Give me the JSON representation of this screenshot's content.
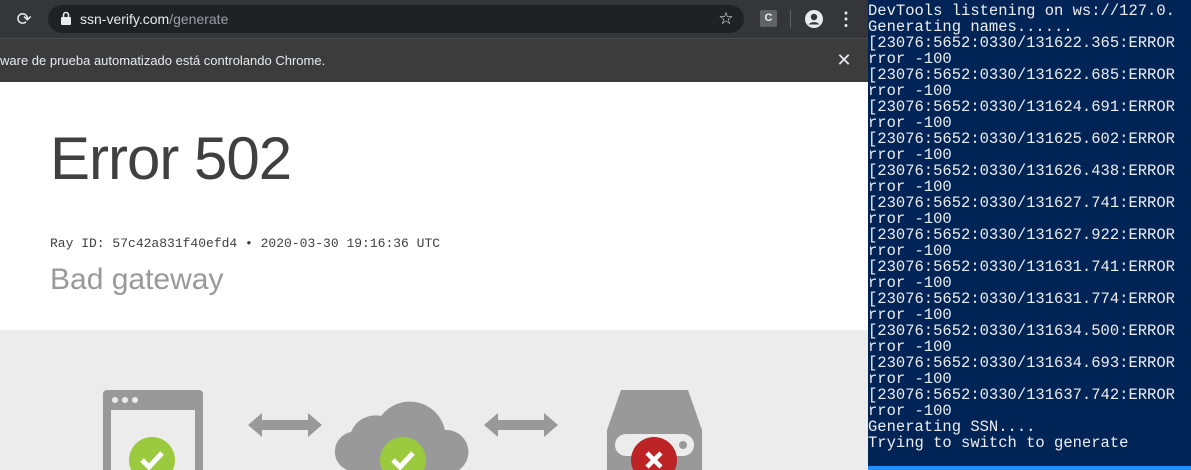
{
  "browser": {
    "url_domain": "ssn-verify.com",
    "url_path": "/generate",
    "infobar_text": "ware de prueba automatizado está controlando Chrome.",
    "extension_label": "C",
    "icons": {
      "reload": "reload-icon",
      "lock": "lock-icon",
      "star": "star-icon",
      "profile": "profile-icon",
      "menu": "menu-icon",
      "close": "close-icon"
    }
  },
  "error_page": {
    "title": "Error 502",
    "ray_id": "Ray ID: 57c42a831f40efd4 • 2020-03-30 19:16:36 UTC",
    "subtitle": "Bad gateway",
    "diagram": [
      {
        "icon": "browser-window-icon",
        "status": "ok"
      },
      {
        "icon": "double-arrow-icon"
      },
      {
        "icon": "cloud-icon",
        "status": "ok"
      },
      {
        "icon": "double-arrow-icon"
      },
      {
        "icon": "server-icon",
        "status": "error"
      }
    ]
  },
  "terminal": {
    "lines": [
      "DevTools listening on ws://127.0.",
      "Generating names......",
      "[23076:5652:0330/131622.365:ERROR",
      "rror -100",
      "[23076:5652:0330/131622.685:ERROR",
      "rror -100",
      "[23076:5652:0330/131624.691:ERROR",
      "rror -100",
      "[23076:5652:0330/131625.602:ERROR",
      "rror -100",
      "[23076:5652:0330/131626.438:ERROR",
      "rror -100",
      "[23076:5652:0330/131627.741:ERROR",
      "rror -100",
      "[23076:5652:0330/131627.922:ERROR",
      "rror -100",
      "[23076:5652:0330/131631.741:ERROR",
      "rror -100",
      "[23076:5652:0330/131631.774:ERROR",
      "rror -100",
      "[23076:5652:0330/131634.500:ERROR",
      "rror -100",
      "[23076:5652:0330/131634.693:ERROR",
      "rror -100",
      "[23076:5652:0330/131637.742:ERROR",
      "rror -100",
      "Generating SSN....",
      "Trying to switch to generate"
    ]
  },
  "colors": {
    "terminal_bg": "#012456",
    "ok_green": "#9bca3e",
    "error_red": "#bd2426",
    "diagram_gray": "#999999"
  }
}
